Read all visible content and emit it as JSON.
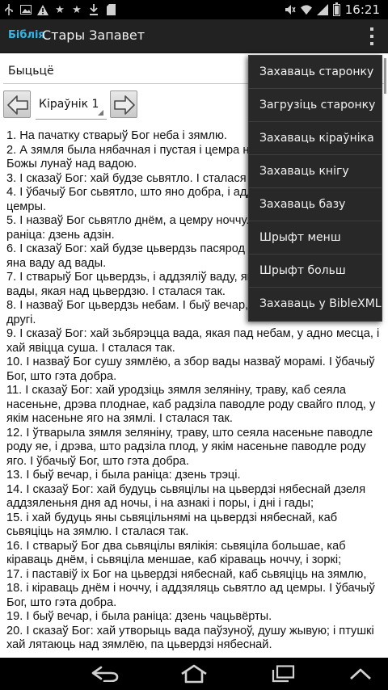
{
  "status_bar": {
    "time": "16:21",
    "left_icons": [
      "usb-icon",
      "image-icon",
      "warning-icon",
      "star-icon",
      "star-icon",
      "download-icon",
      "sd-card-icon"
    ],
    "right_icons": [
      "sound-off-icon",
      "wifi-icon",
      "signal-icon",
      "battery-icon"
    ]
  },
  "action_bar": {
    "logo": "Біблія",
    "title": "Стары Запавет"
  },
  "book_selector": {
    "value": "Быцьцё"
  },
  "chapter_nav": {
    "value": "Кіраўнік 1"
  },
  "verses": [
    "1. На пачатку стварыў Бог неба і зямлю.",
    "2. А зямля была нябачная і пустая і цемра над безданьню, і Дух Божы лунаў над вадою.",
    "3. І сказаў Бог: хай будзе сьвятло. І сталася сьвятло.",
    "4. І ўбачыў Бог сьвятло, што яно добра, і аддзяліў Бог сьвятло ад цемры.",
    "5. І назваў Бог сьвятло днём, а цемру ноччу. І быў вечар, і была раніца: дзень адзін.",
    "6. І сказаў Бог: хай будзе цьвердзь пасярод вады, і хай аддзяляе яна ваду ад вады.",
    "7. І стварыў Бог цьвердзь, і аддзяліў ваду, якая пад цьвердзю, ад вады, якая над цьвердзю. І сталася так.",
    "8. І назваў Бог цьвердзь небам. І быў вечар, і была раніца: дзень другі.",
    "9. І сказаў Бог: хай зьбярэцца вада, якая пад небам, у адно месца, і хай явіцца суша. І сталася так.",
    "10. І назваў Бог сушу зямлёю, а збор вады назваў морамі. І ўбачыў Бог, што гэта добра.",
    "11. І сказаў Бог: хай уродзіць зямля зеляніну, траву, каб сеяла насеньне, дрэва плоднае, каб радзіла паводле роду свайго плод, у якім насеньне яго на зямлі. І сталася так.",
    "12. І ўтварыла зямля зеляніну, траву, што сеяла насеньне паводле роду яе, і дрэва, што радзіла плод, у якім насеньне паводле роду яго. І ўбачыў Бог, што гэта добра.",
    "13. І быў вечар, і была раніца: дзень трэці.",
    "14. І сказаў Бог: хай будуць сьвяцілы на цьвердзі нябеснай дзеля аддзяленьня дня ад ночы, і на азнакі і поры, і дні і гады;",
    "15. і хай будуць яны сьвяцільнямі на цьвердзі нябеснай, каб сьвяціць на зямлю. І сталася так.",
    "16. І стварыў Бог два сьвяцілы вялікія: сьвяціла большае, каб кіраваць днём, і сьвяціла меншае, каб кіраваць ноччу, і зоркі;",
    "17. і паставіў іх Бог на цьвердзі нябеснай, каб сьвяціць на зямлю,",
    "18. і кіраваць днём і ноччу, і аддзяляць сьвятло ад цемры. І ўбачыў Бог, што гэта добра.",
    "19. І быў вечар, і была раніца: дзень чацьвёрты.",
    "20. І сказаў Бог: хай утворыць вада паўзуноў, душу жывую; і птушкі хай лятаюць над зямлёю, па цьвердзі нябеснай."
  ],
  "overflow_menu": {
    "items": [
      {
        "label": "Захаваць старонку"
      },
      {
        "label": "Загрузіць старонку"
      },
      {
        "label": "Захаваць кіраўніка"
      },
      {
        "label": "Захаваць кнігу"
      },
      {
        "label": "Захаваць базу"
      },
      {
        "label": "Шрыфт менш"
      },
      {
        "label": "Шрыфт больш"
      },
      {
        "label": "Захаваць у BibleXML"
      }
    ]
  },
  "nav_bar": {
    "keys": [
      "back-icon",
      "home-icon",
      "recent-apps-icon",
      "collapse-icon"
    ]
  },
  "colors": {
    "action_bar_bg": "#222222",
    "logo_accent": "#33b5e5",
    "menu_bg": "#282828",
    "text": "#111111"
  }
}
